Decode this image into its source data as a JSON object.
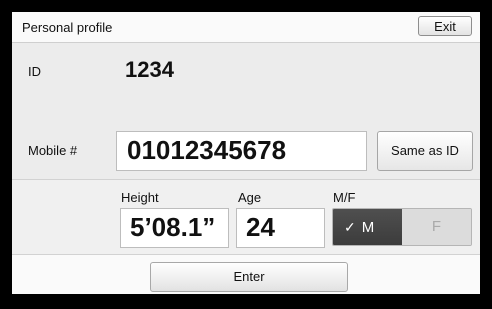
{
  "header": {
    "title": "Personal profile",
    "exit_label": "Exit"
  },
  "id_section": {
    "label": "ID",
    "value": "1234"
  },
  "mobile": {
    "label": "Mobile #",
    "value": "01012345678",
    "same_as_id_label": "Same as ID"
  },
  "height": {
    "label": "Height",
    "value": "5’08.1”"
  },
  "age": {
    "label": "Age",
    "value": "24"
  },
  "gender": {
    "label": "M/F",
    "male_label": "M",
    "female_label": "F",
    "selected": "M",
    "check_icon": "check-icon"
  },
  "footer": {
    "enter_label": "Enter"
  },
  "colors": {
    "selected_segment": "#444444",
    "background": "#f0f0f0",
    "border": "#000000"
  }
}
